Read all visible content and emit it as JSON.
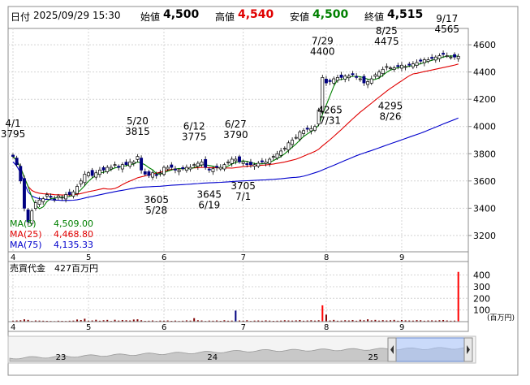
{
  "header": {
    "date_label": "日付",
    "datetime": "2025/09/29 15:30",
    "open_label": "始値",
    "open": "4,500",
    "high_label": "高値",
    "high": "4,540",
    "low_label": "安値",
    "low": "4,500",
    "close_label": "終値",
    "close": "4,515"
  },
  "legend": {
    "ma5": "MA(5)",
    "ma5_value": "4,509.00",
    "ma25": "MA(25)",
    "ma25_value": "4,468.80",
    "ma75": "MA(75)",
    "ma75_value": "4,135.33"
  },
  "volume_title": "売買代金　427百万円",
  "volume_unit": "(百万円)",
  "colors": {
    "ma5": "#008000",
    "ma25": "#e00000",
    "ma75": "#0000cc",
    "up_candle": "#ffffff",
    "down_candle": "#000080",
    "volume_normal": "#800000",
    "volume_high": "#ff0000"
  },
  "chart_data": {
    "type": "candlestick",
    "y_range": [
      3080,
      4720
    ],
    "y_ticks": [
      "4600",
      "4400",
      "4200",
      "4000",
      "3800",
      "3600",
      "3400",
      "3200"
    ],
    "y_tick_values": [
      4600,
      4400,
      4200,
      4000,
      3800,
      3600,
      3400,
      3200
    ],
    "x_month_labels": [
      {
        "label": "4",
        "day": 0
      },
      {
        "label": "5",
        "day": 20
      },
      {
        "label": "6",
        "day": 40
      },
      {
        "label": "7",
        "day": 61
      },
      {
        "label": "8",
        "day": 83
      },
      {
        "label": "9",
        "day": 103
      }
    ],
    "annotations": [
      {
        "date": "4/1",
        "price": "3795",
        "day": 0,
        "value": 3795,
        "pos": "above"
      },
      {
        "date": "5/20",
        "price": "3815",
        "day": 33,
        "value": 3815,
        "pos": "above"
      },
      {
        "date": "6/12",
        "price": "3775",
        "day": 48,
        "value": 3775,
        "pos": "above"
      },
      {
        "date": "6/27",
        "price": "3790",
        "day": 59,
        "value": 3790,
        "pos": "above"
      },
      {
        "date": "7/29",
        "price": "4400",
        "day": 82,
        "value": 4400,
        "pos": "above"
      },
      {
        "date": "8/25",
        "price": "4475",
        "day": 99,
        "value": 4475,
        "pos": "above"
      },
      {
        "date": "9/17",
        "price": "4565",
        "day": 115,
        "value": 4565,
        "pos": "above"
      },
      {
        "date": "5/28",
        "price": "3605",
        "day": 38,
        "value": 3605,
        "pos": "below"
      },
      {
        "date": "6/19",
        "price": "3645",
        "day": 52,
        "value": 3645,
        "pos": "below"
      },
      {
        "date": "7/1",
        "price": "3705",
        "day": 61,
        "value": 3705,
        "pos": "below"
      },
      {
        "date": "7/31",
        "price": "4265",
        "day": 84,
        "value": 4265,
        "pos": "below"
      },
      {
        "date": "8/26",
        "price": "4295",
        "day": 100,
        "value": 4295,
        "pos": "below"
      }
    ],
    "closes": [
      3780,
      3720,
      3600,
      3400,
      3300,
      3380,
      3440,
      3460,
      3470,
      3500,
      3480,
      3460,
      3490,
      3480,
      3500,
      3500,
      3520,
      3560,
      3600,
      3650,
      3660,
      3640,
      3660,
      3680,
      3680,
      3700,
      3700,
      3720,
      3700,
      3720,
      3720,
      3740,
      3740,
      3780,
      3680,
      3650,
      3640,
      3660,
      3640,
      3660,
      3700,
      3700,
      3700,
      3680,
      3680,
      3690,
      3700,
      3700,
      3720,
      3730,
      3740,
      3700,
      3680,
      3690,
      3700,
      3700,
      3720,
      3740,
      3760,
      3760,
      3740,
      3740,
      3720,
      3720,
      3720,
      3730,
      3740,
      3740,
      3760,
      3780,
      3800,
      3820,
      3840,
      3880,
      3900,
      3920,
      3960,
      3970,
      3980,
      3985,
      4000,
      4120,
      4360,
      4320,
      4330,
      4350,
      4360,
      4360,
      4370,
      4370,
      4380,
      4360,
      4350,
      4320,
      4330,
      4350,
      4380,
      4400,
      4420,
      4440,
      4430,
      4430,
      4440,
      4450,
      4440,
      4450,
      4460,
      4470,
      4480,
      4490,
      4490,
      4500,
      4510,
      4520,
      4530,
      4520,
      4510,
      4510,
      4515
    ],
    "volumes": [
      8,
      10,
      12,
      20,
      15,
      6,
      10,
      9,
      8,
      7,
      6,
      5,
      8,
      7,
      6,
      8,
      9,
      18,
      14,
      25,
      8,
      10,
      16,
      8,
      12,
      15,
      6,
      16,
      9,
      14,
      12,
      10,
      18,
      20,
      12,
      7,
      8,
      10,
      6,
      9,
      8,
      10,
      7,
      9,
      6,
      8,
      11,
      9,
      30,
      12,
      10,
      6,
      9,
      8,
      10,
      7,
      12,
      8,
      9,
      95,
      10,
      8,
      12,
      6,
      9,
      10,
      8,
      11,
      9,
      7,
      8,
      9,
      12,
      10,
      9,
      11,
      14,
      8,
      10,
      12,
      9,
      12,
      140,
      60,
      10,
      15,
      8,
      9,
      12,
      10,
      14,
      8,
      16,
      12,
      20,
      11,
      15,
      9,
      13,
      10,
      12,
      15,
      8,
      14,
      11,
      10,
      9,
      13,
      12,
      8,
      10,
      11,
      9,
      12,
      14,
      10,
      8,
      9,
      427
    ],
    "volume_range": [
      0,
      460
    ],
    "volume_ticks": [
      "400",
      "300",
      "200",
      "100"
    ],
    "volume_tick_values": [
      400,
      300,
      200,
      100
    ],
    "navigator_labels": [
      {
        "label": "23",
        "pos": 0.1
      },
      {
        "label": "24",
        "pos": 0.43
      },
      {
        "label": "25",
        "pos": 0.78
      }
    ]
  }
}
